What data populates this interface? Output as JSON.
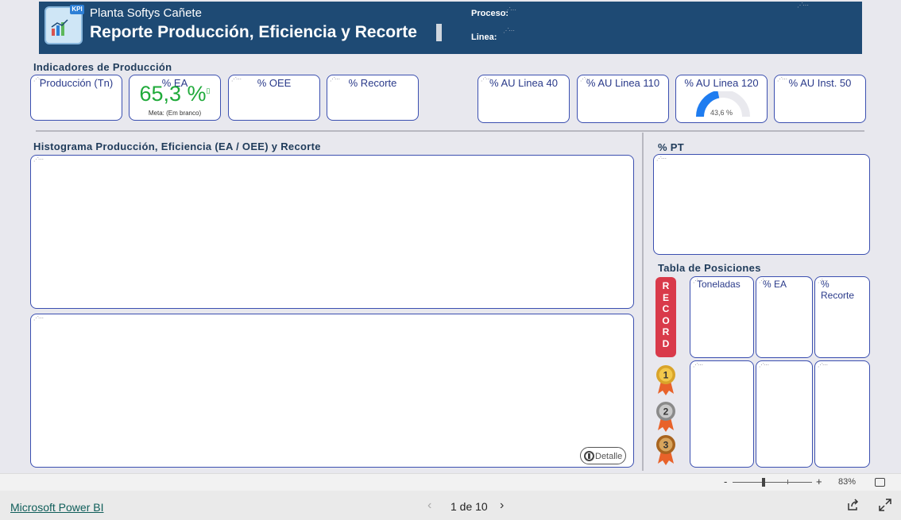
{
  "header": {
    "subtitle": "Planta Softys Cañete",
    "title": "Reporte Producción, Eficiencia y Recorte",
    "proceso_label": "Proceso:",
    "linea_label": "Linea:",
    "logo_badge": "KPI"
  },
  "indicators": {
    "section_title": "Indicadores de Producción",
    "cards": [
      {
        "caption": "Producción (Tn)"
      },
      {
        "caption": "% EA",
        "value": "65,3 %",
        "meta": "Meta: (Em branco)"
      },
      {
        "caption": "% OEE"
      },
      {
        "caption": "% Recorte"
      },
      {
        "caption": "% AU Linea 40"
      },
      {
        "caption": "% AU Linea 110"
      },
      {
        "caption": "% AU Linea 120",
        "gauge_value": "43,6 %",
        "gauge_fraction": 0.436
      },
      {
        "caption": "% AU Inst. 50"
      }
    ]
  },
  "histogram": {
    "section_title": "Histograma Producción, Eficiencia (EA / OEE) y Recorte",
    "detail_button": "Detalle"
  },
  "pt": {
    "section_title": "% PT"
  },
  "positions": {
    "section_title": "Tabla de Posiciones",
    "record_label": "RECORD",
    "columns": [
      "Toneladas",
      "% EA",
      "% Recorte"
    ],
    "medals": [
      "1",
      "2",
      "3"
    ]
  },
  "zoom": {
    "minus": "-",
    "plus": "+",
    "level": "83%"
  },
  "footer": {
    "brand": "Microsoft Power BI",
    "page_indicator": "1 de 10",
    "prev": "‹",
    "next": "›"
  },
  "colors": {
    "header_bg": "#1e4a74",
    "accent_green": "#1faa3a",
    "record_red": "#d93a4a",
    "gauge_blue": "#1e7cf0"
  }
}
